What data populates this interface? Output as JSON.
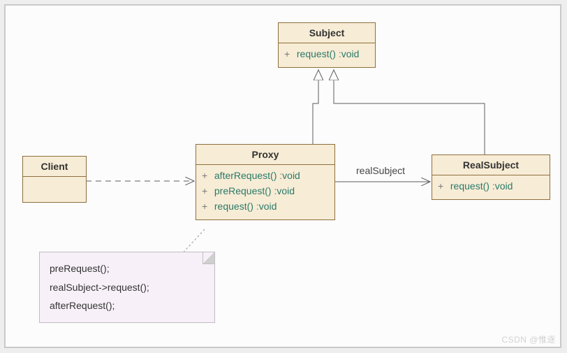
{
  "classes": {
    "subject": {
      "name": "Subject",
      "methods": [
        {
          "visibility": "+",
          "signature": "request()",
          "return": "void"
        }
      ]
    },
    "proxy": {
      "name": "Proxy",
      "methods": [
        {
          "visibility": "+",
          "signature": "afterRequest()",
          "return": "void"
        },
        {
          "visibility": "+",
          "signature": "preRequest()",
          "return": "void"
        },
        {
          "visibility": "+",
          "signature": "request()",
          "return": "void"
        }
      ]
    },
    "realsubject": {
      "name": "RealSubject",
      "methods": [
        {
          "visibility": "+",
          "signature": "request()",
          "return": "void"
        }
      ]
    },
    "client": {
      "name": "Client"
    }
  },
  "associations": {
    "proxy_to_realsubject": {
      "label": "realSubject"
    }
  },
  "relationships": [
    {
      "from": "Proxy",
      "to": "Subject",
      "type": "generalization"
    },
    {
      "from": "RealSubject",
      "to": "Subject",
      "type": "generalization"
    },
    {
      "from": "Client",
      "to": "Proxy",
      "type": "dependency"
    },
    {
      "from": "Proxy",
      "to": "RealSubject",
      "type": "association",
      "role": "realSubject"
    },
    {
      "from": "Proxy",
      "to": "Note",
      "type": "note-link"
    }
  ],
  "note": {
    "lines": [
      "preRequest();",
      "realSubject->request();",
      "afterRequest();"
    ]
  },
  "watermark": "CSDN @惟逐"
}
